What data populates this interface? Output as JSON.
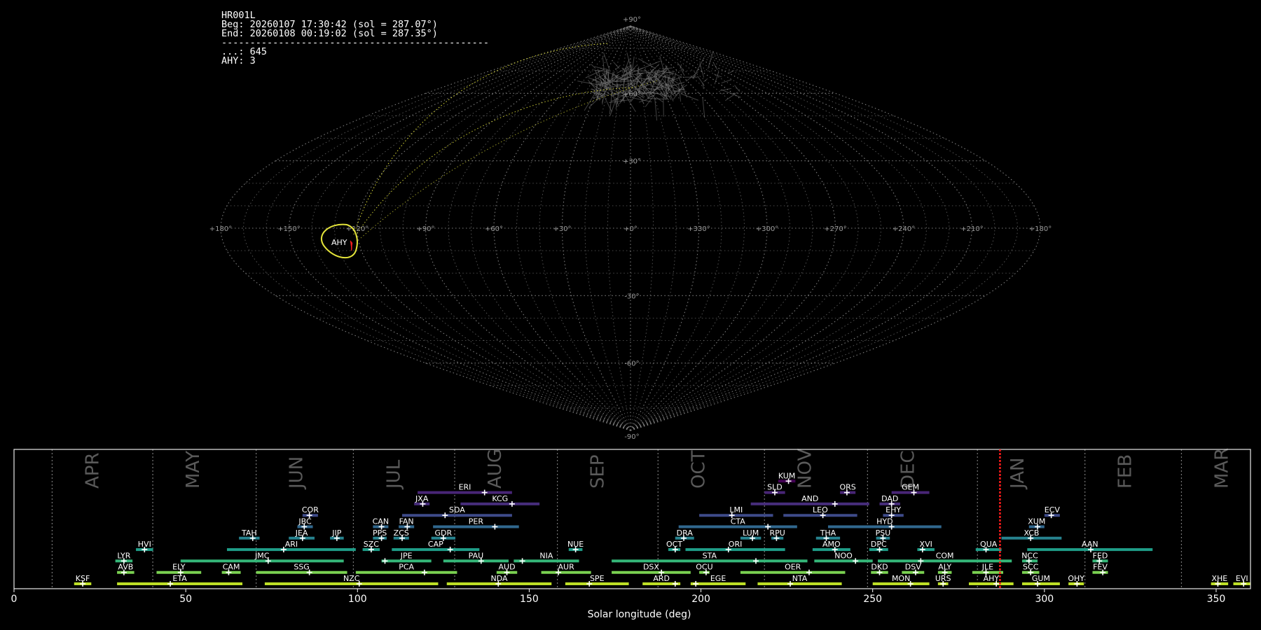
{
  "info": {
    "lines": [
      "HR001L",
      "Beg: 20260107 17:30:42 (sol = 287.07°)",
      "End: 20260108 00:19:02 (sol = 287.35°)",
      "-----------------------------------------------",
      "...: 645",
      "AHY: 3"
    ]
  },
  "sky_map": {
    "type": "sinusoidal-projection",
    "grid": true,
    "lon_tick_labels": [
      "+180°",
      "+150°",
      "+120°",
      "+90°",
      "+60°",
      "+30°",
      "+0°",
      "+330°",
      "+300°",
      "+270°",
      "+240°",
      "+210°",
      "+180°"
    ],
    "lat_tick_labels": [
      "+90°",
      "+60°",
      "+30°",
      "-30°",
      "-60°",
      "-90°"
    ],
    "shower_marker": {
      "code": "AHY",
      "lon": 125,
      "lat": -13
    },
    "colors": {
      "grid": "#8a8a8a",
      "trail": "#e3e33a",
      "radiant": "#ff2020",
      "tracks": "#777777"
    }
  },
  "chart_data": {
    "type": "range",
    "xlabel": "Solar longitude (deg)",
    "xlim": [
      0,
      360
    ],
    "xticks": [
      0,
      50,
      100,
      150,
      200,
      250,
      300,
      350
    ],
    "current_sol": 287.07,
    "months": [
      {
        "label": "APR",
        "start": 11.1
      },
      {
        "label": "MAY",
        "start": 40.4
      },
      {
        "label": "JUN",
        "start": 70.5
      },
      {
        "label": "JUL",
        "start": 98.8
      },
      {
        "label": "AUG",
        "start": 128.3
      },
      {
        "label": "SEP",
        "start": 158.2
      },
      {
        "label": "OCT",
        "start": 187.5
      },
      {
        "label": "NOV",
        "start": 218.5
      },
      {
        "label": "DEC",
        "start": 248.5
      },
      {
        "label": "JAN",
        "start": 280.5
      },
      {
        "label": "FEB",
        "start": 311.8
      },
      {
        "label": "MAR",
        "start": 339.9
      }
    ],
    "showers": [
      {
        "code": "KSF",
        "start": 17.5,
        "end": 22.5,
        "peak": 20,
        "row": 0,
        "color": "#bddf26"
      },
      {
        "code": "ETA",
        "start": 30,
        "end": 66.5,
        "peak": 45.5,
        "row": 0,
        "color": "#bddf26"
      },
      {
        "code": "NZC",
        "start": 73,
        "end": 123.5,
        "peak": 100.5,
        "row": 0,
        "color": "#bddf26"
      },
      {
        "code": "NDA",
        "start": 126,
        "end": 156.5,
        "peak": 141,
        "row": 0,
        "color": "#bddf26"
      },
      {
        "code": "SPE",
        "start": 160.5,
        "end": 179,
        "peak": 167.5,
        "row": 0,
        "color": "#bddf26"
      },
      {
        "code": "ARD",
        "start": 183,
        "end": 194,
        "peak": 192.5,
        "row": 0,
        "color": "#bddf26"
      },
      {
        "code": "EGE",
        "start": 197,
        "end": 213,
        "peak": 198.5,
        "row": 0,
        "color": "#bddf26"
      },
      {
        "code": "NTA",
        "start": 216.5,
        "end": 241,
        "peak": 226,
        "row": 0,
        "color": "#bddf26"
      },
      {
        "code": "MON",
        "start": 250,
        "end": 266.5,
        "peak": 261,
        "row": 0,
        "color": "#bddf26"
      },
      {
        "code": "URS",
        "start": 269,
        "end": 272,
        "peak": 270.5,
        "row": 0,
        "color": "#bddf26"
      },
      {
        "code": "AHY",
        "start": 278,
        "end": 291,
        "peak": 286,
        "row": 0,
        "color": "#bddf26"
      },
      {
        "code": "GUM",
        "start": 293.5,
        "end": 304.5,
        "peak": 298,
        "row": 0,
        "color": "#bddf26"
      },
      {
        "code": "OHY",
        "start": 307,
        "end": 311.5,
        "peak": 309.5,
        "row": 0,
        "color": "#bddf26"
      },
      {
        "code": "XHE",
        "start": 348.5,
        "end": 353.5,
        "peak": 350.5,
        "row": 0,
        "color": "#bddf26"
      },
      {
        "code": "EVI",
        "start": 355,
        "end": 360,
        "peak": 358,
        "row": 0,
        "color": "#bddf26"
      },
      {
        "code": "AVB",
        "start": 30,
        "end": 35,
        "peak": 32,
        "row": 1,
        "color": "#7ad151"
      },
      {
        "code": "ELY",
        "start": 41.5,
        "end": 54.5,
        "peak": 48.5,
        "row": 1,
        "color": "#7ad151"
      },
      {
        "code": "CAM",
        "start": 60.5,
        "end": 66,
        "peak": 62.5,
        "row": 1,
        "color": "#7ad151"
      },
      {
        "code": "SSG",
        "start": 70.5,
        "end": 97,
        "peak": 86,
        "row": 1,
        "color": "#7ad151"
      },
      {
        "code": "PCA",
        "start": 99.5,
        "end": 129,
        "peak": 119.5,
        "row": 1,
        "color": "#7ad151"
      },
      {
        "code": "AUD",
        "start": 140.5,
        "end": 146.5,
        "peak": 143.5,
        "row": 1,
        "color": "#7ad151"
      },
      {
        "code": "AUR",
        "start": 153.5,
        "end": 168,
        "peak": 158.5,
        "row": 1,
        "color": "#7ad151"
      },
      {
        "code": "DSX",
        "start": 174,
        "end": 197,
        "peak": 188.5,
        "row": 1,
        "color": "#7ad151"
      },
      {
        "code": "OCU",
        "start": 199.5,
        "end": 202.5,
        "peak": 201.5,
        "row": 1,
        "color": "#7ad151"
      },
      {
        "code": "OER",
        "start": 211.5,
        "end": 242,
        "peak": 231.5,
        "row": 1,
        "color": "#7ad151"
      },
      {
        "code": "DKD",
        "start": 249.5,
        "end": 254.5,
        "peak": 252,
        "row": 1,
        "color": "#7ad151"
      },
      {
        "code": "DSV",
        "start": 258.5,
        "end": 265,
        "peak": 262.5,
        "row": 1,
        "color": "#7ad151"
      },
      {
        "code": "ALY",
        "start": 269,
        "end": 273,
        "peak": 271,
        "row": 1,
        "color": "#7ad151"
      },
      {
        "code": "JLE",
        "start": 279,
        "end": 288,
        "peak": 283,
        "row": 1,
        "color": "#7ad151"
      },
      {
        "code": "SCC",
        "start": 293.5,
        "end": 298.5,
        "peak": 296,
        "row": 1,
        "color": "#7ad151"
      },
      {
        "code": "FEV",
        "start": 314,
        "end": 318.5,
        "peak": 317,
        "row": 1,
        "color": "#7ad151"
      },
      {
        "code": "LYR",
        "start": 29.5,
        "end": 34.5,
        "peak": 32,
        "row": 2,
        "color": "#35b779"
      },
      {
        "code": "JMC",
        "start": 48.5,
        "end": 96,
        "peak": 74,
        "row": 2,
        "color": "#35b779"
      },
      {
        "code": "JPE",
        "start": 107,
        "end": 121.5,
        "peak": 108,
        "row": 2,
        "color": "#35b779"
      },
      {
        "code": "PAU",
        "start": 125,
        "end": 144,
        "peak": 136,
        "row": 2,
        "color": "#35b779"
      },
      {
        "code": "NIA",
        "start": 145.5,
        "end": 164.5,
        "peak": 148,
        "row": 2,
        "color": "#35b779"
      },
      {
        "code": "STA",
        "start": 174,
        "end": 231,
        "peak": 216,
        "row": 2,
        "color": "#35b779"
      },
      {
        "code": "NOO",
        "start": 233,
        "end": 250,
        "peak": 245,
        "row": 2,
        "color": "#35b779"
      },
      {
        "code": "COM",
        "start": 251.5,
        "end": 290.5,
        "peak": 264,
        "row": 2,
        "color": "#35b779"
      },
      {
        "code": "NCC",
        "start": 293.5,
        "end": 298,
        "peak": 295.5,
        "row": 2,
        "color": "#35b779"
      },
      {
        "code": "FED",
        "start": 314,
        "end": 318.5,
        "peak": 316,
        "row": 2,
        "color": "#35b779"
      },
      {
        "code": "HVI",
        "start": 35.5,
        "end": 40.5,
        "peak": 38,
        "row": 3,
        "color": "#1f9e89"
      },
      {
        "code": "ARI",
        "start": 62,
        "end": 99.5,
        "peak": 78.5,
        "row": 3,
        "color": "#1f9e89"
      },
      {
        "code": "SZC",
        "start": 101.5,
        "end": 106.5,
        "peak": 104,
        "row": 3,
        "color": "#1f9e89"
      },
      {
        "code": "CAP",
        "start": 110,
        "end": 135.5,
        "peak": 127,
        "row": 3,
        "color": "#1f9e89"
      },
      {
        "code": "NUE",
        "start": 161.5,
        "end": 165.5,
        "peak": 163.5,
        "row": 3,
        "color": "#1f9e89"
      },
      {
        "code": "OCT",
        "start": 190.5,
        "end": 194,
        "peak": 192.5,
        "row": 3,
        "color": "#1f9e89"
      },
      {
        "code": "ORI",
        "start": 195.5,
        "end": 224.5,
        "peak": 208,
        "row": 3,
        "color": "#1f9e89"
      },
      {
        "code": "AMO",
        "start": 232.5,
        "end": 243.5,
        "peak": 239,
        "row": 3,
        "color": "#1f9e89"
      },
      {
        "code": "DPC",
        "start": 249,
        "end": 254.5,
        "peak": 252,
        "row": 3,
        "color": "#1f9e89"
      },
      {
        "code": "XVI",
        "start": 263,
        "end": 268,
        "peak": 264.5,
        "row": 3,
        "color": "#1f9e89"
      },
      {
        "code": "QUA",
        "start": 280,
        "end": 287.5,
        "peak": 283,
        "row": 3,
        "color": "#1f9e89"
      },
      {
        "code": "AAN",
        "start": 295,
        "end": 331.5,
        "peak": 313.5,
        "row": 3,
        "color": "#1f9e89"
      },
      {
        "code": "TAH",
        "start": 65.5,
        "end": 71.5,
        "peak": 69.5,
        "row": 4,
        "color": "#26828e"
      },
      {
        "code": "JEA",
        "start": 80,
        "end": 87.5,
        "peak": 84,
        "row": 4,
        "color": "#26828e"
      },
      {
        "code": "JIP",
        "start": 92,
        "end": 96,
        "peak": 94,
        "row": 4,
        "color": "#26828e"
      },
      {
        "code": "PPS",
        "start": 104.5,
        "end": 108.5,
        "peak": 107,
        "row": 4,
        "color": "#26828e"
      },
      {
        "code": "ZCS",
        "start": 110.5,
        "end": 115,
        "peak": 113,
        "row": 4,
        "color": "#26828e"
      },
      {
        "code": "GDR",
        "start": 121.5,
        "end": 128.5,
        "peak": 125,
        "row": 4,
        "color": "#26828e"
      },
      {
        "code": "DRA",
        "start": 192.5,
        "end": 198,
        "peak": 195,
        "row": 4,
        "color": "#26828e"
      },
      {
        "code": "LUM",
        "start": 211.5,
        "end": 217.5,
        "peak": 215,
        "row": 4,
        "color": "#26828e"
      },
      {
        "code": "RPU",
        "start": 220.5,
        "end": 224,
        "peak": 222,
        "row": 4,
        "color": "#26828e"
      },
      {
        "code": "THA",
        "start": 233.5,
        "end": 240.5,
        "peak": 236.5,
        "row": 4,
        "color": "#26828e"
      },
      {
        "code": "PSU",
        "start": 251,
        "end": 255,
        "peak": 253,
        "row": 4,
        "color": "#26828e"
      },
      {
        "code": "XCB",
        "start": 287.5,
        "end": 305,
        "peak": 296,
        "row": 4,
        "color": "#26828e"
      },
      {
        "code": "JBC",
        "start": 82.5,
        "end": 87,
        "peak": 84.5,
        "row": 5,
        "color": "#31688e"
      },
      {
        "code": "CAN",
        "start": 104.5,
        "end": 109,
        "peak": 107,
        "row": 5,
        "color": "#31688e"
      },
      {
        "code": "FAN",
        "start": 112,
        "end": 116.5,
        "peak": 114.5,
        "row": 5,
        "color": "#31688e"
      },
      {
        "code": "PER",
        "start": 122,
        "end": 147,
        "peak": 140,
        "row": 5,
        "color": "#31688e"
      },
      {
        "code": "CTA",
        "start": 193.5,
        "end": 228,
        "peak": 219.5,
        "row": 5,
        "color": "#31688e"
      },
      {
        "code": "HYD",
        "start": 237,
        "end": 270,
        "peak": 255.5,
        "row": 5,
        "color": "#31688e"
      },
      {
        "code": "XUM",
        "start": 295.5,
        "end": 300,
        "peak": 298,
        "row": 5,
        "color": "#31688e"
      },
      {
        "code": "COR",
        "start": 84,
        "end": 88.5,
        "peak": 86,
        "row": 6,
        "color": "#3e4a89"
      },
      {
        "code": "SDA",
        "start": 113,
        "end": 145,
        "peak": 125.5,
        "row": 6,
        "color": "#3e4a89"
      },
      {
        "code": "LMI",
        "start": 199.5,
        "end": 221,
        "peak": 209,
        "row": 6,
        "color": "#3e4a89"
      },
      {
        "code": "LEO",
        "start": 224,
        "end": 245.5,
        "peak": 235.5,
        "row": 6,
        "color": "#3e4a89"
      },
      {
        "code": "EHY",
        "start": 253,
        "end": 259,
        "peak": 255.5,
        "row": 6,
        "color": "#3e4a89"
      },
      {
        "code": "ECV",
        "start": 300,
        "end": 304.5,
        "peak": 302,
        "row": 6,
        "color": "#3e4a89"
      },
      {
        "code": "JXA",
        "start": 116.5,
        "end": 121,
        "peak": 119,
        "row": 7,
        "color": "#472d7b"
      },
      {
        "code": "KCG",
        "start": 130,
        "end": 153,
        "peak": 145,
        "row": 7,
        "color": "#472d7b"
      },
      {
        "code": "AND",
        "start": 214.5,
        "end": 249,
        "peak": 239,
        "row": 7,
        "color": "#472d7b"
      },
      {
        "code": "DAD",
        "start": 252,
        "end": 258,
        "peak": 255.5,
        "row": 7,
        "color": "#472d7b"
      },
      {
        "code": "ERI",
        "start": 117.5,
        "end": 145,
        "peak": 137,
        "row": 8,
        "color": "#482576"
      },
      {
        "code": "SLD",
        "start": 218.5,
        "end": 224.5,
        "peak": 221.5,
        "row": 8,
        "color": "#482576"
      },
      {
        "code": "ORS",
        "start": 240.5,
        "end": 245,
        "peak": 242.5,
        "row": 8,
        "color": "#482576"
      },
      {
        "code": "GEM",
        "start": 255.5,
        "end": 266.5,
        "peak": 262,
        "row": 8,
        "color": "#482576"
      },
      {
        "code": "KUM",
        "start": 222.5,
        "end": 227.5,
        "peak": 225.5,
        "row": 9,
        "color": "#440154"
      }
    ]
  }
}
